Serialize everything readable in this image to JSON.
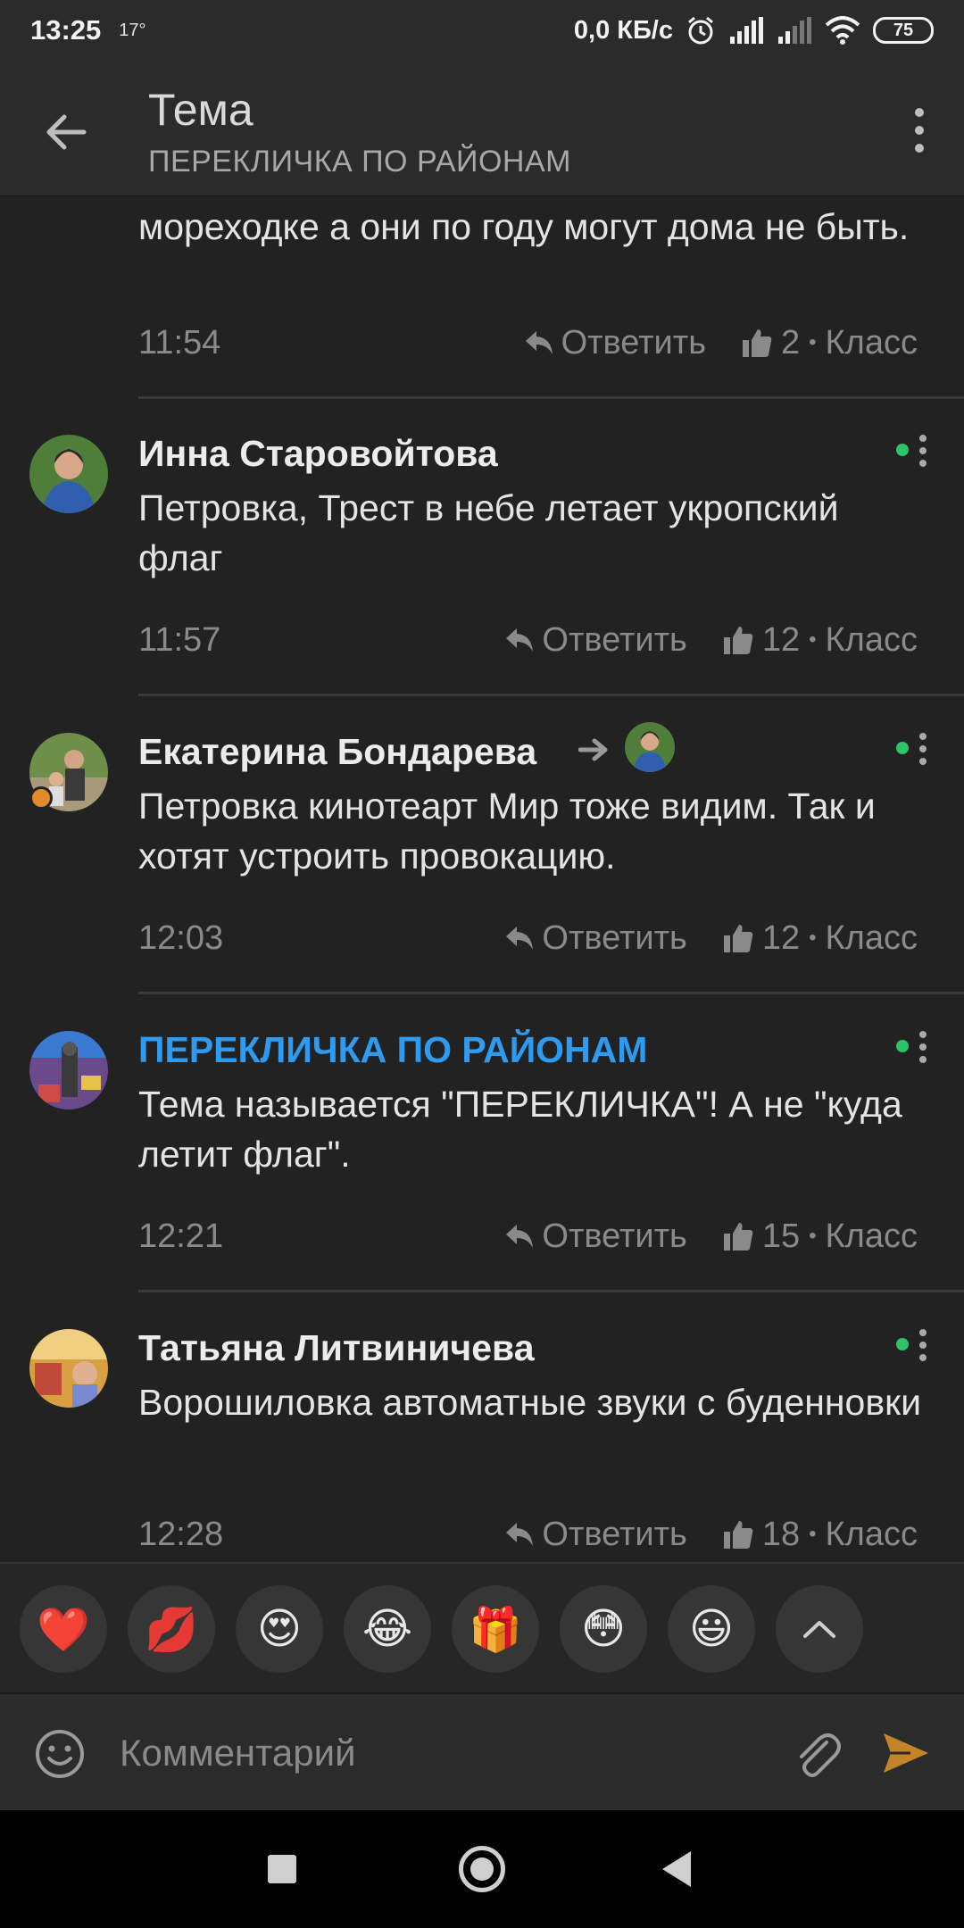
{
  "status_bar": {
    "time": "13:25",
    "temperature": "17°",
    "speed": "0,0 КБ/с",
    "battery": "75"
  },
  "app_bar": {
    "title": "Тема",
    "subtitle": "ПЕРЕКЛИЧКА ПО РАЙОНАМ"
  },
  "actions": {
    "reply_label": "Ответить",
    "like_label": "Класс",
    "separator": "•"
  },
  "comments": [
    {
      "author": "",
      "text": "мореходке а они по году могут дома не быть.",
      "time": "11:54",
      "likes": "2"
    },
    {
      "author": "Инна Старовойтова",
      "text": "Петровка, Трест в небе летает укропский флаг",
      "time": "11:57",
      "likes": "12"
    },
    {
      "author": "Екатерина Бондарева",
      "text": "Петровка кинотеарт Мир тоже видим. Так и хотят устроить провокацию.",
      "time": "12:03",
      "likes": "12"
    },
    {
      "author": "ПЕРЕКЛИЧКА ПО РАЙОНАМ",
      "text": "Тема называется \"ПЕРЕКЛИЧКА\"! А не \"куда летит флаг\".",
      "time": "12:21",
      "likes": "15"
    },
    {
      "author": "Татьяна Литвиничева",
      "text": "Ворошиловка автоматные звуки с буденновки",
      "time": "12:28",
      "likes": "18"
    }
  ],
  "reactions": [
    "❤️",
    "💋",
    "😍",
    "😂",
    "🎁",
    "😳",
    "😃"
  ],
  "composer": {
    "placeholder": "Комментарий"
  },
  "colors": {
    "background": "#222222",
    "accent_link": "#2e9bf0",
    "online": "#2ec26a",
    "send": "#c6842a"
  }
}
